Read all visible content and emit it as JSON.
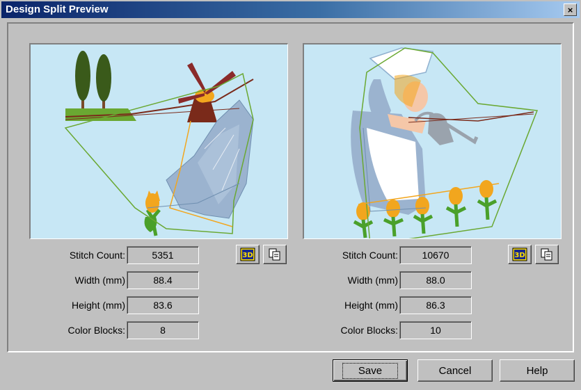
{
  "window": {
    "title": "Design Split Preview",
    "close_label": "×"
  },
  "left_design": {
    "stitch_count_label": "Stitch Count:",
    "stitch_count": "5351",
    "width_label": "Width (mm)",
    "width": "88.4",
    "height_label": "Height (mm)",
    "height": "83.6",
    "color_blocks_label": "Color Blocks:",
    "color_blocks": "8"
  },
  "right_design": {
    "stitch_count_label": "Stitch Count:",
    "stitch_count": "10670",
    "width_label": "Width (mm)",
    "width": "88.0",
    "height_label": "Height (mm)",
    "height": "86.3",
    "color_blocks_label": "Color Blocks:",
    "color_blocks": "10"
  },
  "buttons": {
    "save": "Save",
    "cancel": "Cancel",
    "help": "Help"
  },
  "icons": {
    "view_3d": "3d-view-icon",
    "copy": "copy-icon"
  },
  "colors": {
    "preview_background": "#c7e7f5",
    "titlebar_start": "#0a246a",
    "titlebar_end": "#a6caf0",
    "dialog_face": "#c0c0c0"
  }
}
